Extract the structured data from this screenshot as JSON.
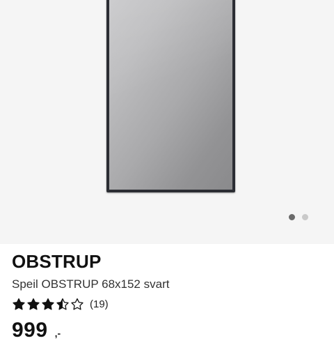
{
  "product": {
    "name": "OBSTRUP",
    "description": "Speil OBSTRUP 68x152 svart",
    "rating": {
      "stars": 3.5,
      "max": 5,
      "review_count_text": "(19)"
    },
    "price": {
      "value": "999",
      "unit": ",-"
    }
  },
  "gallery": {
    "image_count": 2,
    "active_index": 0
  },
  "colors": {
    "frame": "#2b2d33",
    "star": "#111111",
    "dot_active": "#6a6a6a",
    "dot_inactive": "#c9c9c9"
  }
}
